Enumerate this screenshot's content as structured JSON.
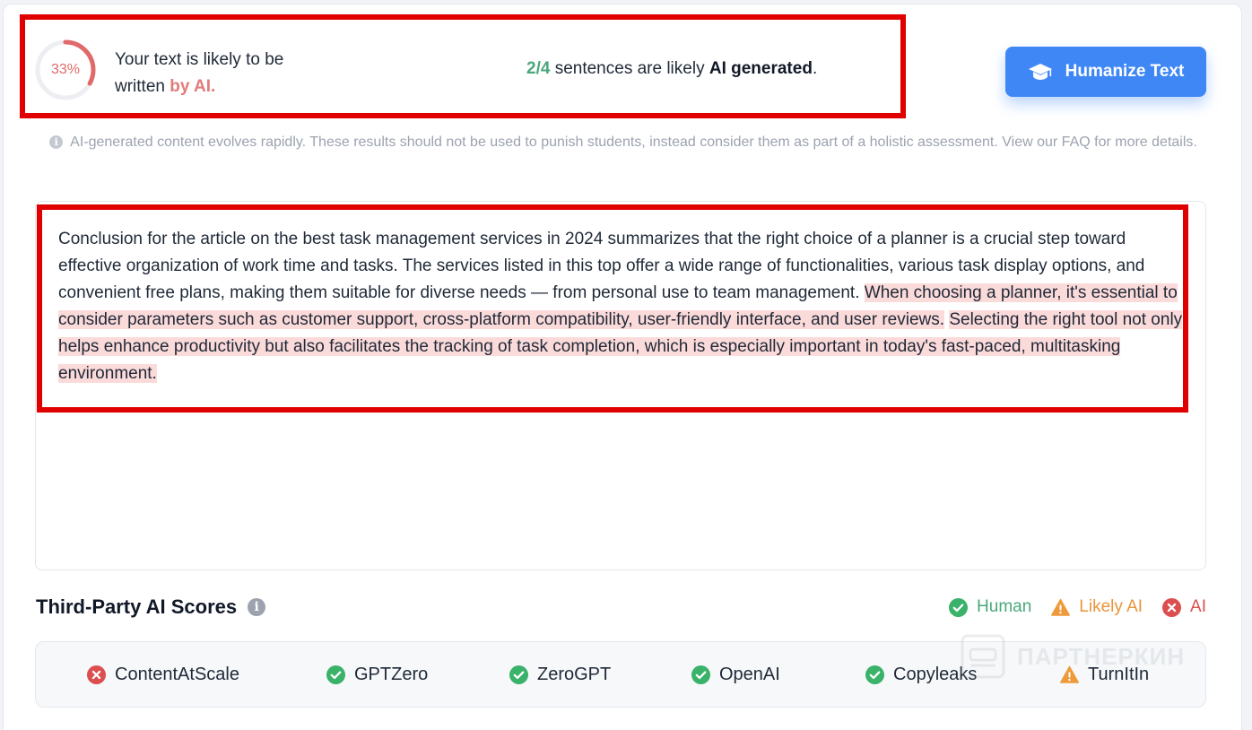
{
  "summary": {
    "score": "33%",
    "score_fraction": 0.33,
    "verdict_line1": "Your text is likely to be",
    "verdict_line2": "written",
    "verdict_ai": "by AI.",
    "sentence_count": "2/4",
    "sentence_text": " sentences are likely ",
    "sentence_bold": "AI generated",
    "sentence_end": "."
  },
  "actions": {
    "humanize_label": "Humanize Text"
  },
  "disclaimer": "AI-generated content evolves rapidly. These results should not be used to punish students, instead consider them as part of a holistic assessment. View our FAQ for more details.",
  "analyzed_text": {
    "plain": "Conclusion for the article on the best task management services in 2024 summarizes that the right choice of a planner is a crucial step toward effective organization of work time and tasks. The services listed in this top offer a wide range of functionalities, various task display options, and convenient free plans, making them suitable for diverse needs — from personal use to team management. ",
    "ai_sentence_1": "When choosing a planner, it's essential to consider parameters such as customer support, cross-platform compatibility, user-friendly interface, and user reviews.",
    "separator": " ",
    "ai_sentence_2": "Selecting the right tool not only helps enhance productivity but also facilitates the tracking of task completion, which is especially important in today's fast-paced, multitasking environment."
  },
  "third_party": {
    "title": "Third-Party AI Scores",
    "legend": {
      "human": "Human",
      "likely_ai": "Likely AI",
      "ai": "AI"
    },
    "detectors": [
      {
        "name": "ContentAtScale",
        "status": "ai"
      },
      {
        "name": "GPTZero",
        "status": "human"
      },
      {
        "name": "ZeroGPT",
        "status": "human"
      },
      {
        "name": "OpenAI",
        "status": "human"
      },
      {
        "name": "Copyleaks",
        "status": "human"
      },
      {
        "name": "TurnItIn",
        "status": "likely_ai"
      }
    ]
  },
  "watermark": "ПАРТНЕРКИН",
  "colors": {
    "accent": "#3f87f5",
    "human": "#3ab26a",
    "likely_ai": "#ef9a3a",
    "ai": "#dc4f4f",
    "ai_highlight": "#fbdada",
    "annotation": "#e00000"
  }
}
